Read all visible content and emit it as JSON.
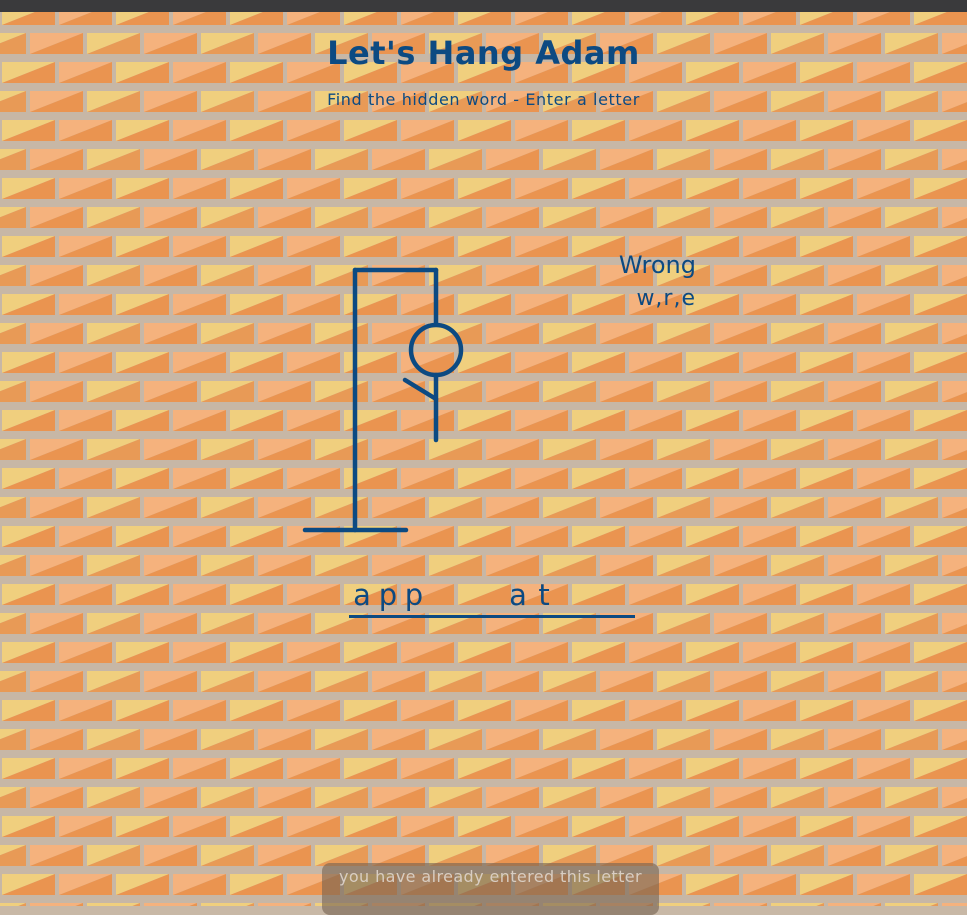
{
  "game": {
    "title": "Let's Hang Adam",
    "instruction": "Find the hidden word - Enter a letter"
  },
  "wrong": {
    "label": "Wrong",
    "letters": "w,r,e",
    "count": 3
  },
  "word": {
    "slots": [
      "a",
      "p",
      "p",
      "",
      "",
      "",
      "a",
      "t",
      "",
      "",
      ""
    ]
  },
  "message": "you have already entered this letter",
  "colors": {
    "ink": "#0c4a82",
    "mortar": "#c7b7a6",
    "brick_orange": "#ea9450",
    "brick_peach": "#f5b27d",
    "brick_yellow": "#f0cf7e"
  }
}
